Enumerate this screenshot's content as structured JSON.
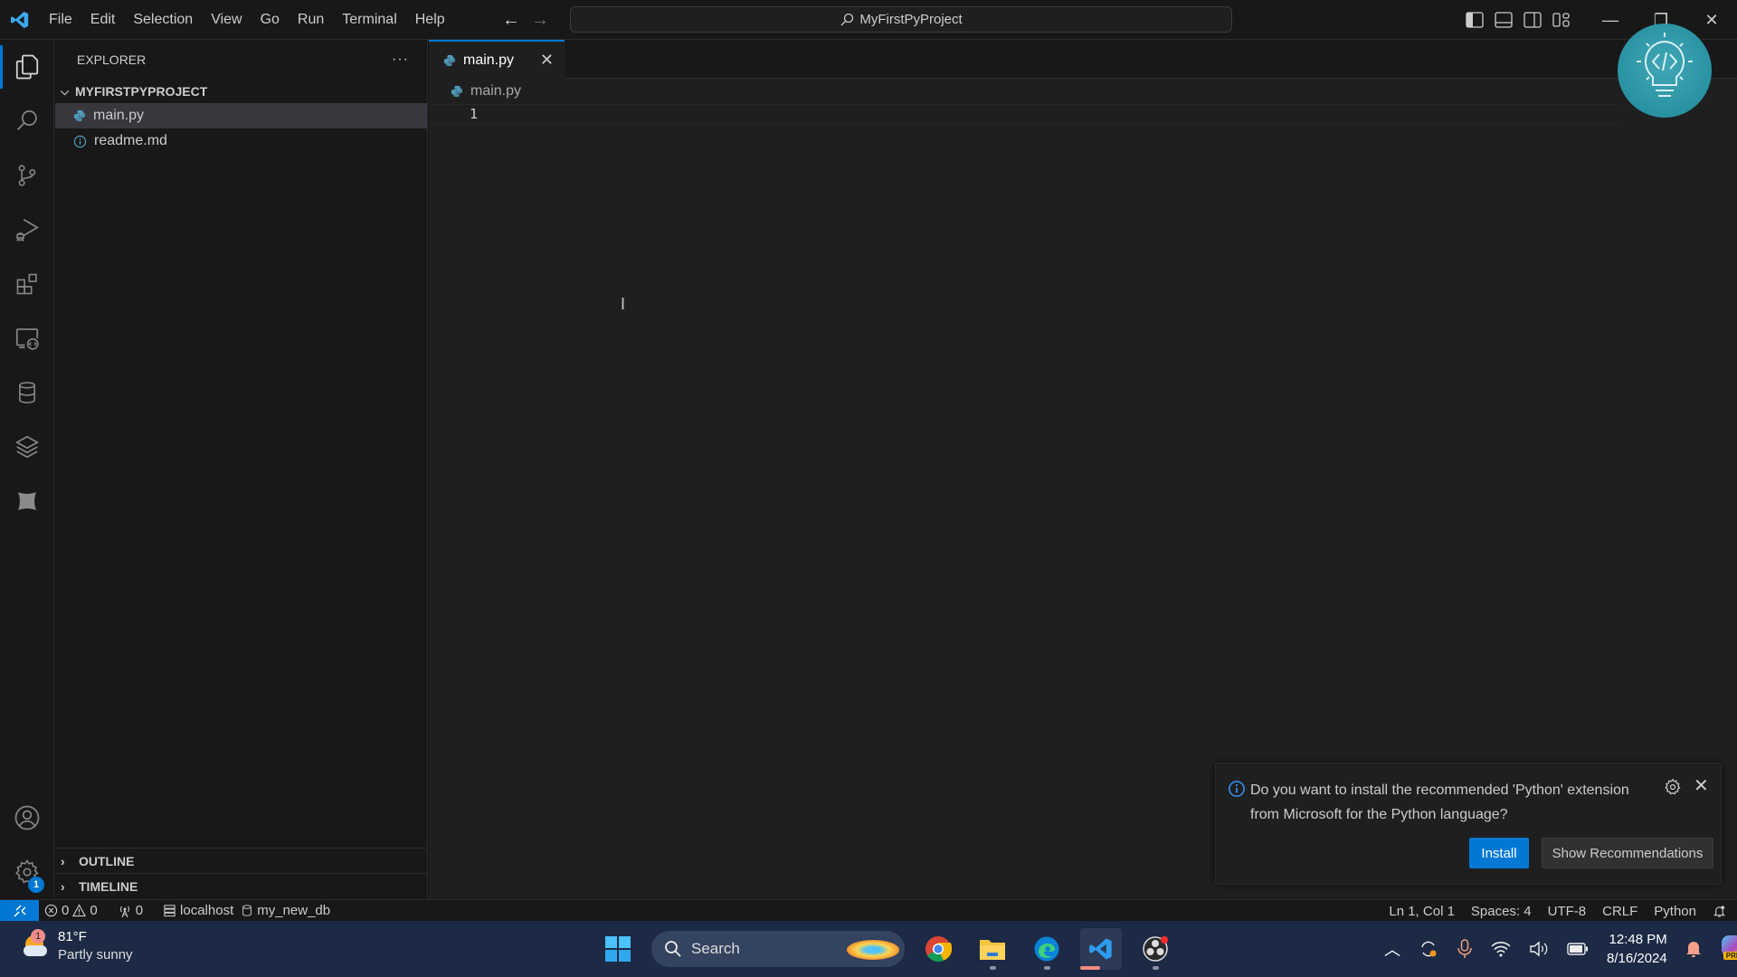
{
  "titlebar": {
    "menu": [
      "File",
      "Edit",
      "Selection",
      "View",
      "Go",
      "Run",
      "Terminal",
      "Help"
    ],
    "command_center": "MyFirstPyProject",
    "back_icon": "arrow-left-icon",
    "forward_icon": "arrow-right-icon"
  },
  "activity_bar": {
    "items": [
      {
        "name": "explorer",
        "icon": "files-icon",
        "active": true
      },
      {
        "name": "search",
        "icon": "search-icon"
      },
      {
        "name": "source-control",
        "icon": "source-control-icon"
      },
      {
        "name": "run-debug",
        "icon": "run-debug-icon"
      },
      {
        "name": "extensions",
        "icon": "extensions-icon"
      },
      {
        "name": "remote-explorer",
        "icon": "remote-explorer-icon"
      },
      {
        "name": "database",
        "icon": "database-icon"
      },
      {
        "name": "layers",
        "icon": "layers-icon"
      },
      {
        "name": "x-extension",
        "icon": "x-icon"
      }
    ],
    "bottom": [
      {
        "name": "accounts",
        "icon": "account-icon"
      },
      {
        "name": "manage",
        "icon": "gear-icon",
        "badge": "1"
      }
    ]
  },
  "sidebar": {
    "title": "EXPLORER",
    "more_label": "···",
    "project": "MYFIRSTPYPROJECT",
    "files": [
      {
        "name": "main.py",
        "icon": "python-icon",
        "selected": true
      },
      {
        "name": "readme.md",
        "icon": "info-icon",
        "selected": false
      }
    ],
    "sections": [
      "OUTLINE",
      "TIMELINE"
    ]
  },
  "editor": {
    "tabs": [
      {
        "label": "main.py",
        "icon": "python-icon",
        "active": true
      }
    ],
    "breadcrumb": "main.py",
    "lines": [
      "1"
    ]
  },
  "notification": {
    "message": "Do you want to install the recommended 'Python' extension from Microsoft for the Python language?",
    "primary": "Install",
    "secondary": "Show Recommendations"
  },
  "statusbar": {
    "errors": "0",
    "warnings": "0",
    "ports": "0",
    "host": "localhost",
    "db": "my_new_db",
    "position": "Ln 1, Col 1",
    "spaces": "Spaces: 4",
    "encoding": "UTF-8",
    "eol": "CRLF",
    "language": "Python"
  },
  "taskbar": {
    "weather_temp": "81°F",
    "weather_desc": "Partly sunny",
    "weather_badge": "1",
    "search": "Search",
    "apps": [
      "start",
      "search",
      "chrome",
      "file-explorer",
      "edge",
      "vscode",
      "obs"
    ],
    "time": "12:48 PM",
    "date": "8/16/2024",
    "copilot_label": "PRE"
  },
  "colors": {
    "accent": "#0078d4",
    "bg": "#1f1f1f",
    "sidebar": "#181818",
    "taskbar": "#1c2a45"
  }
}
